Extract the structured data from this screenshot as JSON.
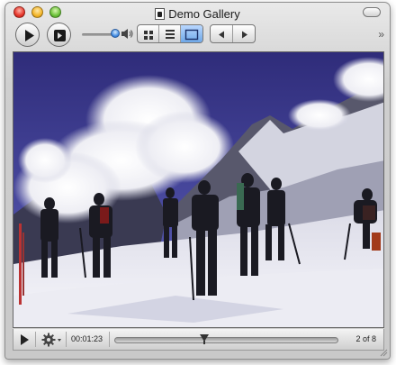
{
  "window": {
    "title": "Demo Gallery"
  },
  "toolbar": {
    "volume_level": 0.8,
    "view_modes": [
      "grid",
      "list",
      "single"
    ],
    "active_view": "single",
    "overflow_symbol": "»"
  },
  "viewer": {
    "image_description_icon": "photo-skiers-mountain"
  },
  "status": {
    "time": "00:01:23",
    "position": 0.4,
    "count": "2 of 8"
  },
  "colors": {
    "accent": "#3d88e0",
    "sky": "#3d3b8e",
    "close": "#e6362b",
    "minimize": "#f3b52a",
    "zoom": "#6cc23a"
  }
}
